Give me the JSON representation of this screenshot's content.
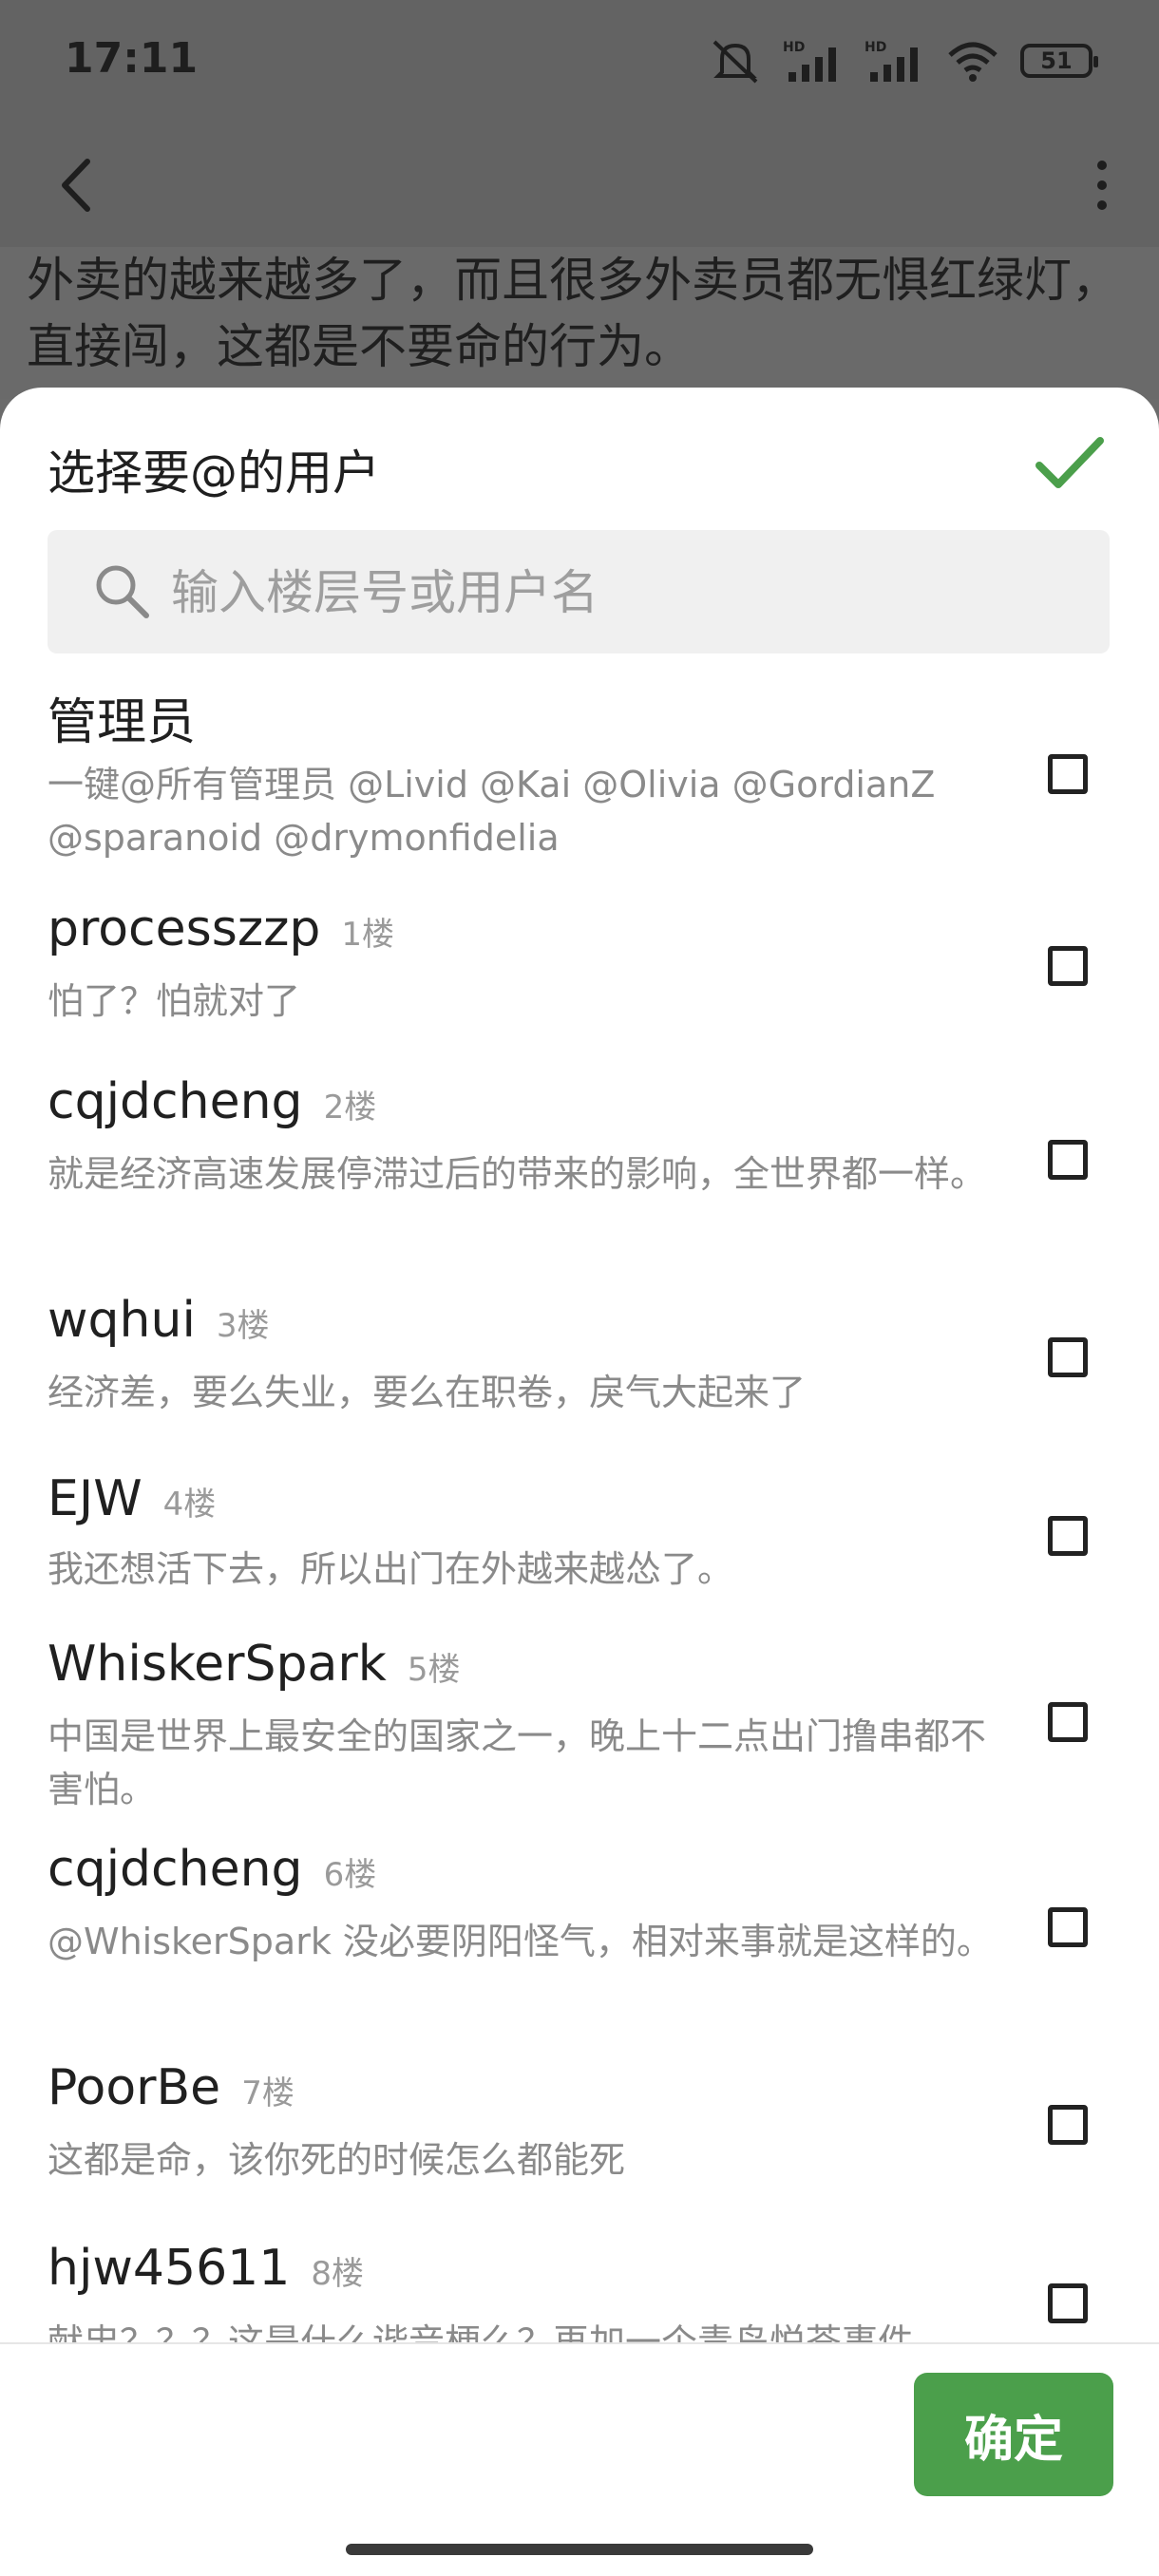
{
  "status_bar": {
    "time": "17:11",
    "battery": "51"
  },
  "background": {
    "post_text": "外卖的越来越多了，而且很多外卖员都无惧红绿灯，直接闯，这都是不要命的行为。"
  },
  "sheet": {
    "title": "选择要@的用户",
    "search_placeholder": "输入楼层号或用户名",
    "confirm_label": "确定",
    "accent_color": "#4b9f4b"
  },
  "items": [
    {
      "name": "管理员",
      "floor": "",
      "desc": "一键@所有管理员 @Livid @Kai @Olivia @GordianZ @sparanoid @drymonfidelia"
    },
    {
      "name": "processzzp",
      "floor": "1楼",
      "desc": "怕了？怕就对了"
    },
    {
      "name": "cqjdcheng",
      "floor": "2楼",
      "desc": "就是经济高速发展停滞过后的带来的影响，全世界都一样。"
    },
    {
      "name": "wqhui",
      "floor": "3楼",
      "desc": "经济差，要么失业，要么在职卷，戾气大起来了"
    },
    {
      "name": "EJW",
      "floor": "4楼",
      "desc": "我还想活下去，所以出门在外越来越怂了。"
    },
    {
      "name": "WhiskerSpark",
      "floor": "5楼",
      "desc": "中国是世界上最安全的国家之一，晚上十二点出门撸串都不害怕。"
    },
    {
      "name": "cqjdcheng",
      "floor": "6楼",
      "desc": "@WhiskerSpark 没必要阴阳怪气，相对来事就是这样的。"
    },
    {
      "name": "PoorBe",
      "floor": "7楼",
      "desc": "这都是命，该你死的时候怎么都能死"
    },
    {
      "name": "hjw45611",
      "floor": "8楼",
      "desc": "献忠？？？这是什么谐音梗么？再加一个青岛悦荟事件"
    }
  ]
}
